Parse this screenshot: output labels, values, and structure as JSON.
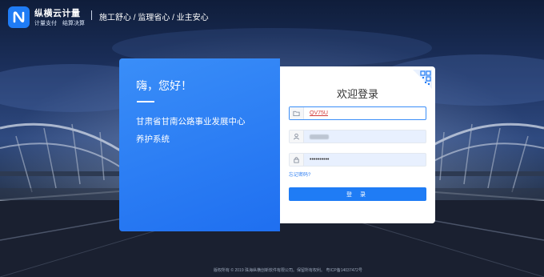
{
  "brand": {
    "name": "纵横云计量",
    "tags": [
      "计量支付",
      "结算决算"
    ],
    "logo_icon": "zongheng-logo-icon",
    "accent": "#1f7cf5"
  },
  "header": {
    "slogan": "施工舒心 / 监理省心 / 业主安心"
  },
  "info_panel": {
    "greeting": "嗨，您好！",
    "org_name": "甘肃省甘南公路事业发展中心",
    "system_name": "养护系统",
    "color": "#2f80f4"
  },
  "login": {
    "title": "欢迎登录",
    "qr_icon": "qr-code-icon",
    "org_field": {
      "icon": "folder-icon",
      "value": "QV75U"
    },
    "user_field": {
      "icon": "user-icon",
      "value": ""
    },
    "password_field": {
      "icon": "lock-icon",
      "value": "••••••••••"
    },
    "forgot_label": "忘记密码?",
    "submit_label": "登 录"
  },
  "footer": {
    "text": "版权所有 © 2019 珠海纵横创新软件有限公司。保留所有权利。 粤ICP备14037472号"
  }
}
